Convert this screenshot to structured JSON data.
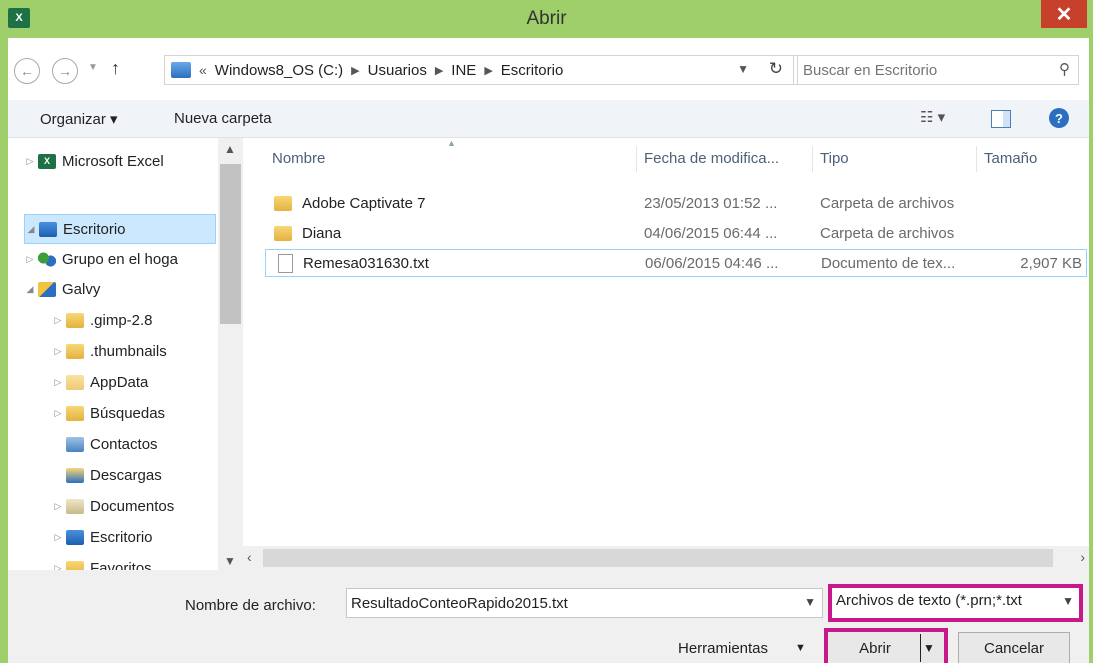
{
  "window": {
    "title": "Abrir",
    "app_icon": "excel-icon",
    "close_label": "✕"
  },
  "address": {
    "overflow": "«",
    "crumbs": [
      "Windows8_OS (C:)",
      "Usuarios",
      "INE",
      "Escritorio"
    ],
    "search_placeholder": "Buscar en Escritorio"
  },
  "toolbar": {
    "organize_label": "Organizar ▾",
    "new_folder_label": "Nueva carpeta",
    "help_label": "?"
  },
  "nav": {
    "items": [
      {
        "label": "Microsoft Excel",
        "icon": "excel-icon"
      },
      {
        "label": "Escritorio",
        "icon": "desktop-icon",
        "selected": true
      },
      {
        "label": "Grupo en el hoga",
        "icon": "homegroup-icon"
      },
      {
        "label": "Galvy",
        "icon": "user-icon"
      },
      {
        "label": ".gimp-2.8",
        "icon": "folder-icon"
      },
      {
        "label": ".thumbnails",
        "icon": "folder-icon"
      },
      {
        "label": "AppData",
        "icon": "folder-icon"
      },
      {
        "label": "Búsquedas",
        "icon": "search-folder-icon"
      },
      {
        "label": "Contactos",
        "icon": "contacts-icon"
      },
      {
        "label": "Descargas",
        "icon": "downloads-icon"
      },
      {
        "label": "Documentos",
        "icon": "documents-icon"
      },
      {
        "label": "Escritorio",
        "icon": "desktop-folder-icon"
      },
      {
        "label": "Favoritos",
        "icon": "favorites-icon"
      }
    ]
  },
  "files": {
    "columns": [
      "Nombre",
      "Fecha de modifica...",
      "Tipo",
      "Tamaño"
    ],
    "rows": [
      {
        "name": "Adobe Captivate 7",
        "date": "23/05/2013 01:52 ...",
        "type": "Carpeta de archivos",
        "size": ""
      },
      {
        "name": "Diana",
        "date": "04/06/2015 06:44 ...",
        "type": "Carpeta de archivos",
        "size": ""
      },
      {
        "name": "Remesa031630.txt",
        "date": "06/06/2015 04:46 ...",
        "type": "Documento de tex...",
        "size": "2,907 KB"
      }
    ]
  },
  "bottom": {
    "filename_label": "Nombre de archivo:",
    "filename_value": "ResultadoConteoRapido2015.txt",
    "filetype_value": "Archivos de texto (*.prn;*.txt",
    "tools_label": "Herramientas",
    "open_label": "Abrir",
    "cancel_label": "Cancelar"
  },
  "colors": {
    "frame": "#9ecf6b",
    "highlight": "#c8198b",
    "close": "#c7402b"
  }
}
